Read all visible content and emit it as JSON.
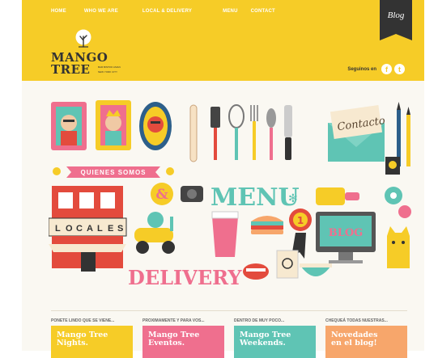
{
  "nav": {
    "items": [
      "HOME",
      "WHO WE ARE",
      "LOCAL & DELIVERY",
      "MENU",
      "CONTACT"
    ]
  },
  "blog_tab": "Blog",
  "logo": {
    "line1": "MANGO",
    "line2": "TREE",
    "tag1": "BAR BISTRO ASIAN",
    "tag2": "NEW YORK CITY"
  },
  "follow": {
    "label": "Seguinos en",
    "facebook_glyph": "f",
    "twitter_glyph": "t"
  },
  "scene": {
    "quienes": "QUIENES SOMOS",
    "contacto": "Contacto",
    "menu": "MENU",
    "locales": [
      "L",
      "O",
      "C",
      "A",
      "L",
      "E",
      "S"
    ],
    "delivery": "DELIVERY",
    "ampersand": "&",
    "rosette": "1",
    "blog": "BLOG"
  },
  "promos": [
    {
      "kicker": "PONETE LINDO QUE SE VIENE...",
      "line1": "Mango Tree",
      "line2": "Nights.",
      "color": "#f6cc27"
    },
    {
      "kicker": "PROXIMAMENTE Y PARA VOS...",
      "line1": "Mango Tree",
      "line2": "Eventos.",
      "color": "#ef6f8e"
    },
    {
      "kicker": "DENTRO DE MUY POCO...",
      "line1": "Mango Tree",
      "line2": "Weekends.",
      "color": "#5fc4b4"
    },
    {
      "kicker": "CHEQUEÁ TODAS NUESTRAS...",
      "line1": "Novedades",
      "line2": "en el blog!",
      "color": "#f7a66b"
    }
  ],
  "colors": {
    "header": "#f6cc27",
    "dark": "#333333",
    "teal": "#5fc4b4",
    "pink": "#ef6f8e",
    "orange": "#f7a66b",
    "red": "#e34b3d"
  }
}
